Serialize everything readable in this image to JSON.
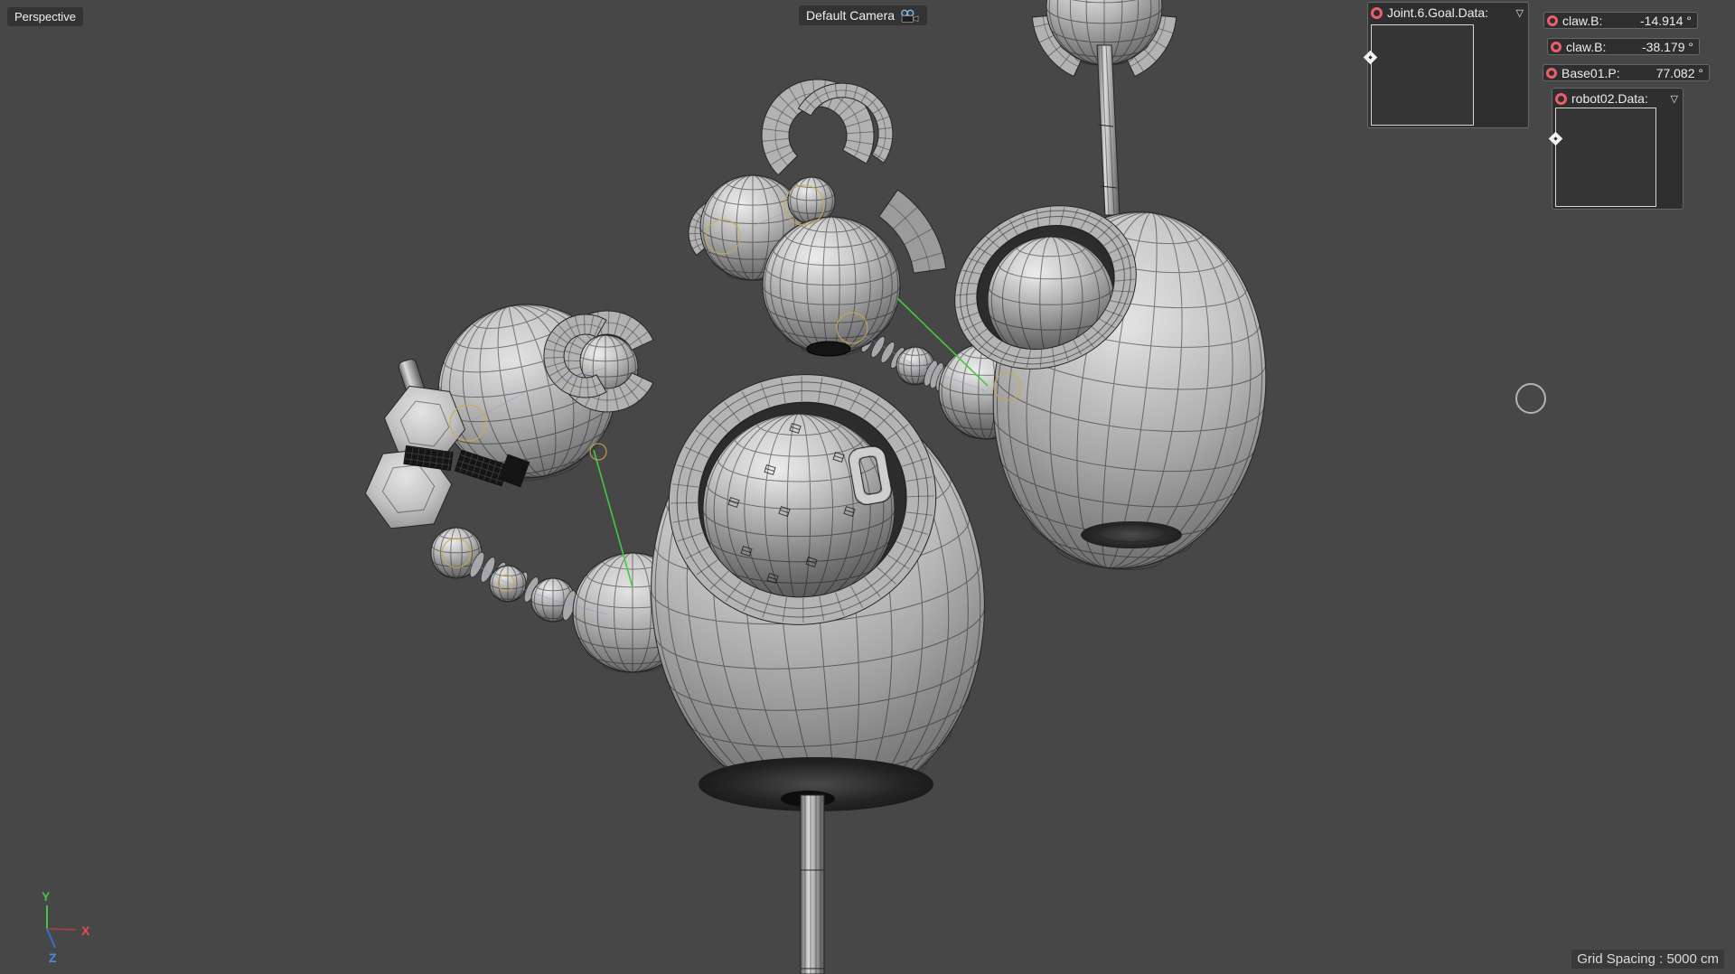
{
  "viewport": {
    "view_label": "Perspective",
    "camera_label": "Default Camera",
    "grid_spacing_label": "Grid Spacing : 5000 cm"
  },
  "hud": {
    "joint_panel": {
      "label": "Joint.6.Goal.Data:",
      "dropdown_icon": "▽"
    },
    "value_rows": [
      {
        "name": "claw.B:",
        "value": "-14.914 °"
      },
      {
        "name": "claw.B:",
        "value": "-38.179 °"
      },
      {
        "name": "Base01.P:",
        "value": "77.082 °"
      }
    ],
    "robot_panel": {
      "label": "robot02.Data:",
      "dropdown_icon": "▽"
    }
  },
  "axis_gizmo": {
    "x": "X",
    "y": "Y",
    "z": "Z"
  },
  "colors": {
    "background": "#474747",
    "viewport_wire": "#262626",
    "surface_mid": "#b4b4b4",
    "hud_panel_bg": "#2f2f2f",
    "hud_border": "#676767",
    "hud_text": "#ececec",
    "record_red": "#e8606e",
    "keyframe_box_border": "#d4d4d4",
    "accent_green": "#43c943",
    "bone_blue": "#7d9cc8",
    "selection_yellow": "#caa94f",
    "axis_x_line": "#9c4040",
    "axis_x_label": "#e05050",
    "axis_y": "#46c24e",
    "axis_z_line": "#3a6ecc",
    "axis_z_label": "#4b8be6",
    "cursor": "#b4b4b4"
  }
}
